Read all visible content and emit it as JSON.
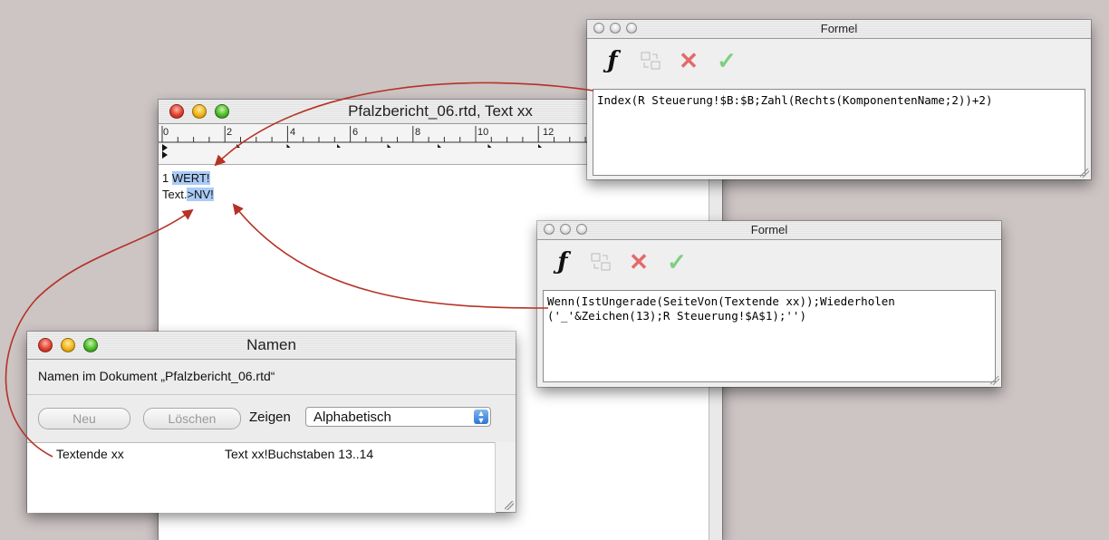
{
  "doc_window": {
    "title": "Pfalzbericht_06.rtd, Text xx",
    "ruler_labels": [
      "0",
      "2",
      "4",
      "6",
      "8",
      "10",
      "12"
    ],
    "lines": [
      {
        "prefix": "1 ",
        "highlight": "WERT!"
      },
      {
        "prefix": "Text.",
        "highlight": ">NV!"
      }
    ]
  },
  "formel_top": {
    "title": "Formel",
    "formula": "Index(R Steuerung!$B:$B;Zahl(Rechts(KomponentenName;2))+2)"
  },
  "formel_mid": {
    "title": "Formel",
    "formula": "Wenn(IstUngerade(SeiteVon(Textende xx));Wiederholen\n('_'&Zeichen(13);R Steuerung!$A$1);'')"
  },
  "toolbar_icons": {
    "fx": "ƒ",
    "insert": "insert-reference-icon",
    "cancel": "✕",
    "accept": "✓"
  },
  "namen_window": {
    "title": "Namen",
    "subtitle": "Namen im Dokument „Pfalzbericht_06.rtd“",
    "new_button": "Neu",
    "delete_button": "Löschen",
    "show_label": "Zeigen",
    "show_value": "Alphabetisch",
    "rows": [
      {
        "name": "Textende xx",
        "ref": "Text xx!Buchstaben 13..14"
      }
    ]
  },
  "colors": {
    "background": "#cdc4c4",
    "highlight": "#aacbf5",
    "arrow": "#b53226"
  }
}
